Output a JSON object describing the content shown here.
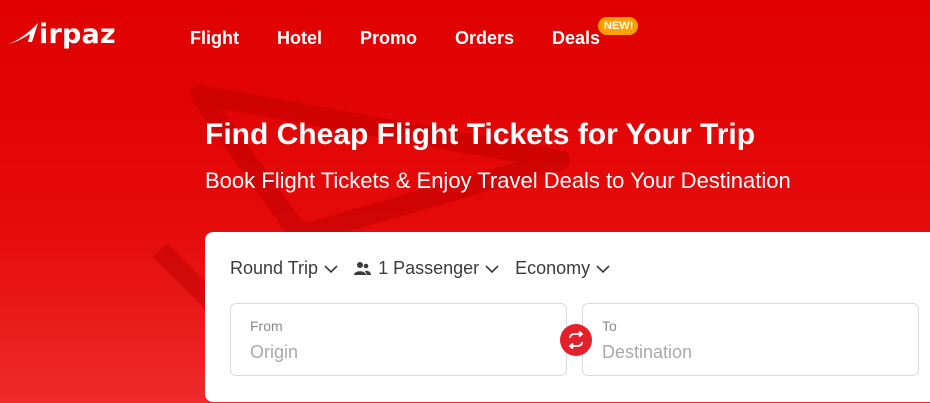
{
  "brand": {
    "name": "irpaz",
    "logo_icon": "airpaz-plane-icon"
  },
  "nav": {
    "items": [
      {
        "label": "Flight"
      },
      {
        "label": "Hotel"
      },
      {
        "label": "Promo"
      },
      {
        "label": "Orders"
      },
      {
        "label": "Deals",
        "badge": "NEW!"
      }
    ]
  },
  "hero": {
    "title": "Find Cheap Flight Tickets for Your Trip",
    "subtitle": "Book Flight Tickets & Enjoy Travel Deals to Your Destination"
  },
  "search": {
    "trip_type": "Round Trip",
    "passengers": "1 Passenger",
    "cabin_class": "Economy",
    "from": {
      "label": "From",
      "placeholder": "Origin"
    },
    "to": {
      "label": "To",
      "placeholder": "Destination"
    }
  },
  "colors": {
    "primary": "#e00000",
    "badge": "#ff9f00",
    "swap_button": "#e4202a"
  }
}
